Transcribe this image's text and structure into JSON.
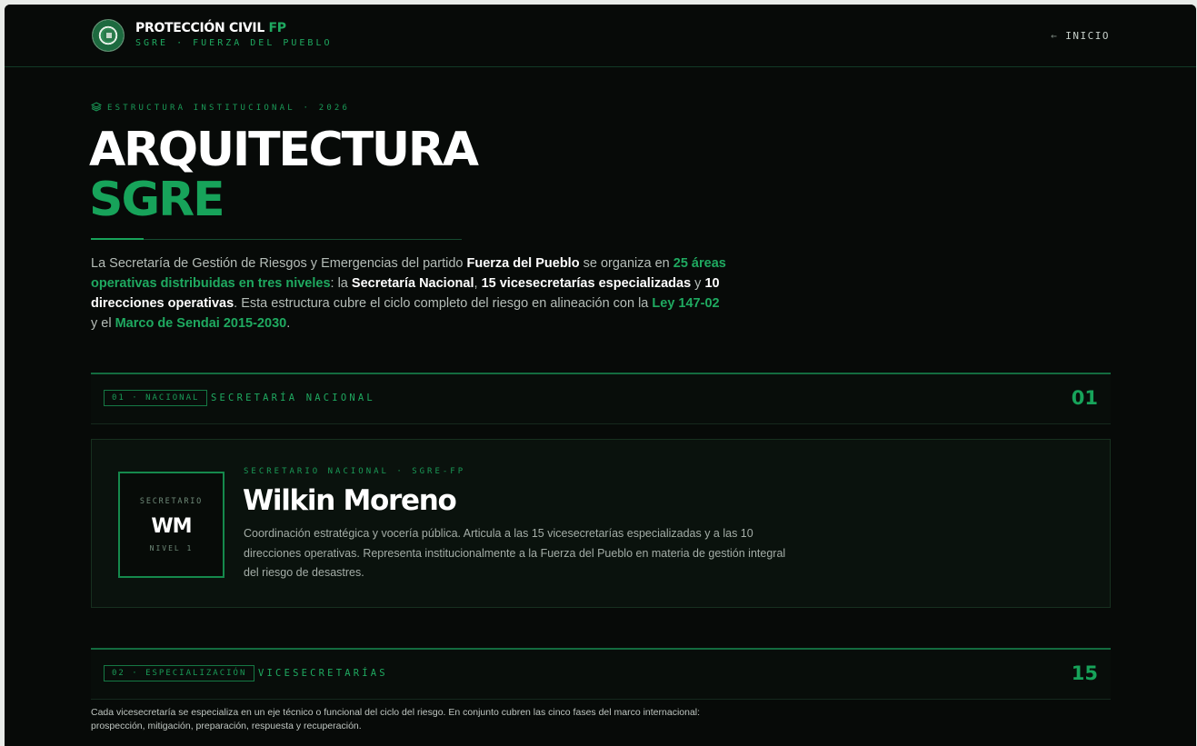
{
  "header": {
    "brand_title": "PROTECCIÓN CIVIL",
    "brand_accent": "FP",
    "brand_subtitle": "SGRE · FUERZA DEL PUEBLO",
    "home_arrow": "←",
    "home_label": "INICIO"
  },
  "hero": {
    "eyebrow": "ESTRUCTURA INSTITUCIONAL · 2026",
    "title": "ARQUITECTURA",
    "title_accent": "SGRE",
    "intro": {
      "p1": "La Secretaría de Gestión de Riesgos y Emergencias del partido ",
      "b1": "Fuerza del Pueblo",
      "p2": " se organiza en ",
      "g1": "25 áreas operativas distribuidas en tres niveles",
      "p3": ": la ",
      "b2": "Secretaría Nacional",
      "p4": ", ",
      "b3": "15 vicesecretarías especializadas",
      "p5": " y ",
      "b4": "10 direcciones operativas",
      "p6": ". Esta estructura cubre el ciclo completo del riesgo en alineación con la ",
      "g2": "Ley 147-02",
      "p7": " y el ",
      "g3": "Marco de Sendai 2015-2030",
      "p8": "."
    }
  },
  "sections": [
    {
      "tag": "01 · NACIONAL",
      "label": "SECRETARÍA NACIONAL",
      "count": "01"
    },
    {
      "tag": "02 · ESPECIALIZACIÓN",
      "label": "VICESECRETARÍAS",
      "count": "15"
    }
  ],
  "secretary": {
    "avatar_top": "SECRETARIO",
    "initials": "WM",
    "avatar_bottom": "NIVEL 1",
    "role": "SECRETARIO NACIONAL · SGRE-FP",
    "name": "Wilkin Moreno",
    "bio": "Coordinación estratégica y vocería pública. Articula a las 15 vicesecretarías especializadas y a las 10 direcciones operativas. Representa institucionalmente a la Fuerza del Pueblo en materia de gestión integral del riesgo de desastres."
  },
  "vice_note": "Cada vicesecretaría se especializa en un eje técnico o funcional del ciclo del riesgo. En conjunto cubren las cinco fases del marco internacional: prospección, mitigación, preparación, respuesta y recuperación.",
  "colors": {
    "background": "#070a08",
    "accent": "#17a35a",
    "text": "#ffffff",
    "muted": "#b5bdb8"
  },
  "icons": {
    "eyebrow": "layers-icon",
    "logo": "emblem-icon",
    "home": "arrow-left-icon"
  }
}
